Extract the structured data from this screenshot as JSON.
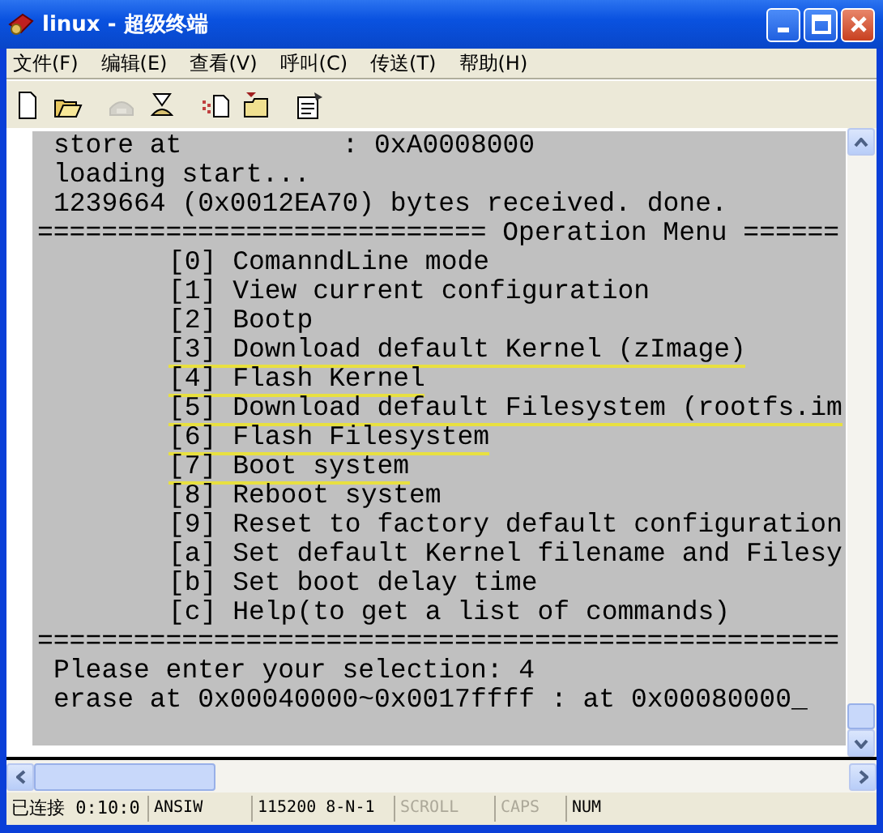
{
  "window": {
    "title": "linux - 超级终端"
  },
  "menu": [
    {
      "label": "文件(F)"
    },
    {
      "label": "编辑(E)"
    },
    {
      "label": "查看(V)"
    },
    {
      "label": "呼叫(C)"
    },
    {
      "label": "传送(T)"
    },
    {
      "label": "帮助(H)"
    }
  ],
  "toolbar": [
    {
      "kind": "new",
      "disabled": false
    },
    {
      "kind": "open",
      "disabled": false
    },
    {
      "kind": "call",
      "disabled": true
    },
    {
      "kind": "hangup",
      "disabled": false
    },
    {
      "kind": "send",
      "disabled": false
    },
    {
      "kind": "receive",
      "disabled": false
    },
    {
      "kind": "properties",
      "disabled": false
    }
  ],
  "terminal": {
    "lines": [
      {
        "kind": "text",
        "text": "store at          : 0xA0008000"
      },
      {
        "kind": "text",
        "text": "loading start..."
      },
      {
        "kind": "text",
        "text": "1239664 (0x0012EA70) bytes received. done."
      },
      {
        "kind": "rule",
        "text": "============================ Operation Menu ======"
      },
      {
        "kind": "item",
        "text": "[0] ComanndLine mode",
        "highlighted": false
      },
      {
        "kind": "item",
        "text": "[1] View current configuration",
        "highlighted": false
      },
      {
        "kind": "item",
        "text": "[2] Bootp",
        "highlighted": false
      },
      {
        "kind": "item",
        "text": "[3] Download default Kernel (zImage)",
        "highlighted": true
      },
      {
        "kind": "item",
        "text": "[4] Flash Kernel",
        "highlighted": true
      },
      {
        "kind": "item",
        "text": "[5] Download default Filesystem (rootfs.im",
        "highlighted": true
      },
      {
        "kind": "item",
        "text": "[6] Flash Filesystem",
        "highlighted": true
      },
      {
        "kind": "item",
        "text": "[7] Boot system",
        "highlighted": true
      },
      {
        "kind": "item",
        "text": "[8] Reboot system",
        "highlighted": false
      },
      {
        "kind": "item",
        "text": "[9] Reset to factory default configuration",
        "highlighted": false
      },
      {
        "kind": "item",
        "text": "[a] Set default Kernel filename and Filesy",
        "highlighted": false
      },
      {
        "kind": "item",
        "text": "[b] Set boot delay time",
        "highlighted": false
      },
      {
        "kind": "item",
        "text": "[c] Help(to get a list of commands)",
        "highlighted": false
      },
      {
        "kind": "rule",
        "text": "=================================================="
      },
      {
        "kind": "text",
        "text": "Please enter your selection: 4"
      },
      {
        "kind": "text",
        "text": "erase at 0x00040000~0x0017ffff : at 0x00080000_"
      }
    ]
  },
  "status_bar": [
    {
      "text": "已连接 0:10:0",
      "disabled": false
    },
    {
      "text": "ANSIW",
      "disabled": false
    },
    {
      "text": "115200 8-N-1",
      "disabled": false
    },
    {
      "text": "SCROLL",
      "disabled": true
    },
    {
      "text": "CAPS",
      "disabled": true
    },
    {
      "text": "NUM",
      "disabled": false
    }
  ]
}
